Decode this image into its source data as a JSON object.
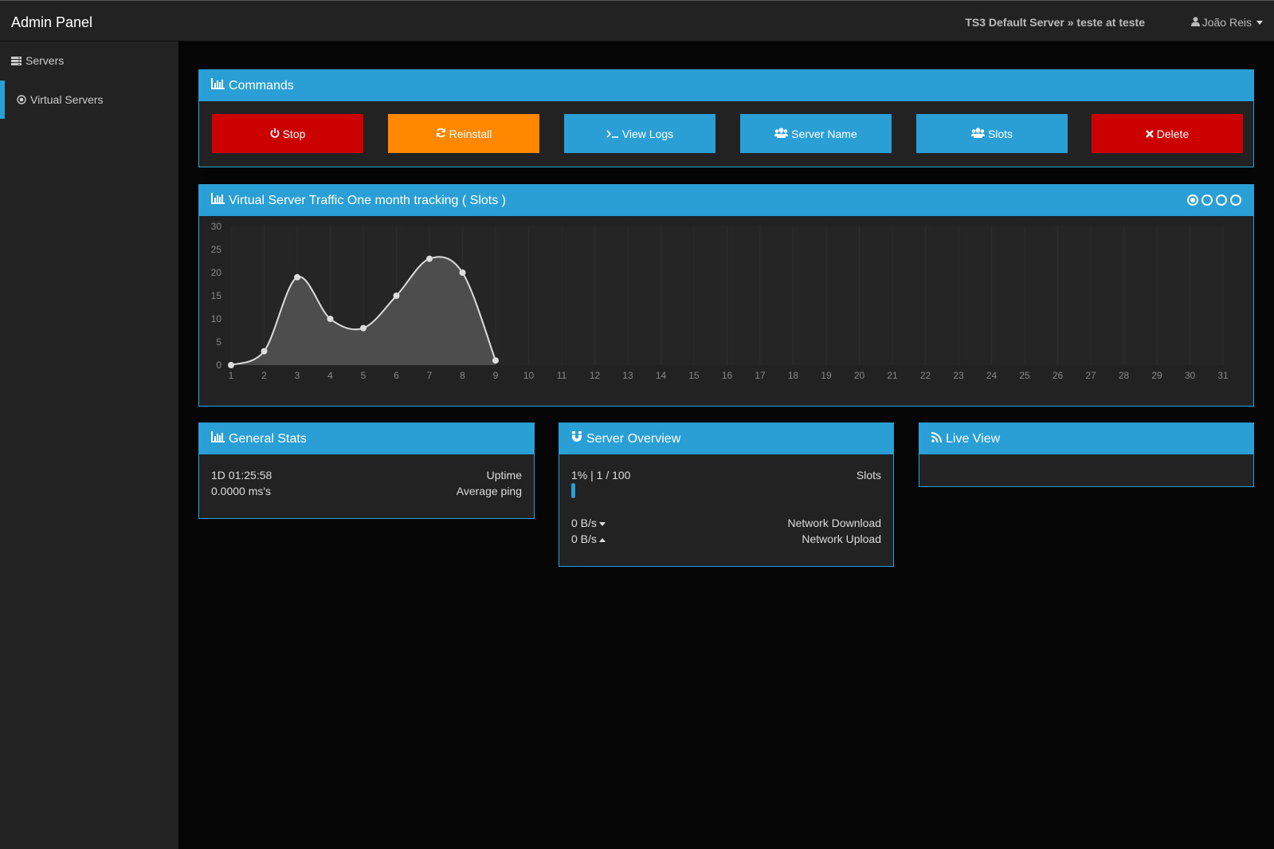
{
  "header": {
    "brand": "Admin Panel",
    "server_crumb": "TS3 Default Server » teste at teste",
    "user_name": "João Reis"
  },
  "sidebar": {
    "items": [
      {
        "label": "Servers",
        "icon": "server-icon",
        "active": false
      },
      {
        "label": "Virtual Servers",
        "icon": "target-icon",
        "active": true
      }
    ]
  },
  "commands": {
    "title": "Commands",
    "buttons": [
      {
        "label": "Stop",
        "icon": "power-icon",
        "color": "#cc0000"
      },
      {
        "label": "Reinstall",
        "icon": "refresh-icon",
        "color": "#ff8800"
      },
      {
        "label": "View Logs",
        "icon": "terminal-icon",
        "color": "#2a9fd6"
      },
      {
        "label": "Server Name",
        "icon": "users-icon",
        "color": "#2a9fd6"
      },
      {
        "label": "Slots",
        "icon": "users-icon",
        "color": "#2a9fd6"
      },
      {
        "label": "Delete",
        "icon": "close-icon",
        "color": "#cc0000"
      }
    ]
  },
  "traffic": {
    "title": "Virtual Server Traffic One month tracking ( Slots )",
    "pager_count": 4,
    "pager_selected": 0
  },
  "chart_data": {
    "type": "area",
    "x": [
      1,
      2,
      3,
      4,
      5,
      6,
      7,
      8,
      9,
      10,
      11,
      12,
      13,
      14,
      15,
      16,
      17,
      18,
      19,
      20,
      21,
      22,
      23,
      24,
      25,
      26,
      27,
      28,
      29,
      30,
      31
    ],
    "series": [
      {
        "values": [
          0,
          3,
          19,
          10,
          8,
          15,
          23,
          20,
          1
        ]
      }
    ],
    "yticks": [
      0,
      5,
      10,
      15,
      20,
      25,
      30
    ],
    "ylim": [
      0,
      30
    ],
    "xlim": [
      1,
      31
    ],
    "grid": true
  },
  "general_stats": {
    "title": "General Stats",
    "rows": [
      {
        "value": "1D 01:25:58",
        "label": "Uptime"
      },
      {
        "value": "0.0000 ms's",
        "label": "Average ping"
      }
    ]
  },
  "server_overview": {
    "title": "Server Overview",
    "slots_value": "1% | 1 / 100",
    "slots_label": "Slots",
    "slots_fraction": 0.01,
    "download_value": "0 B/s",
    "download_label": "Network Download",
    "upload_value": "0 B/s",
    "upload_label": "Network Upload"
  },
  "live_view": {
    "title": "Live View"
  },
  "colors": {
    "accent": "#2a9fd6",
    "danger": "#cc0000",
    "warning": "#ff8800"
  }
}
